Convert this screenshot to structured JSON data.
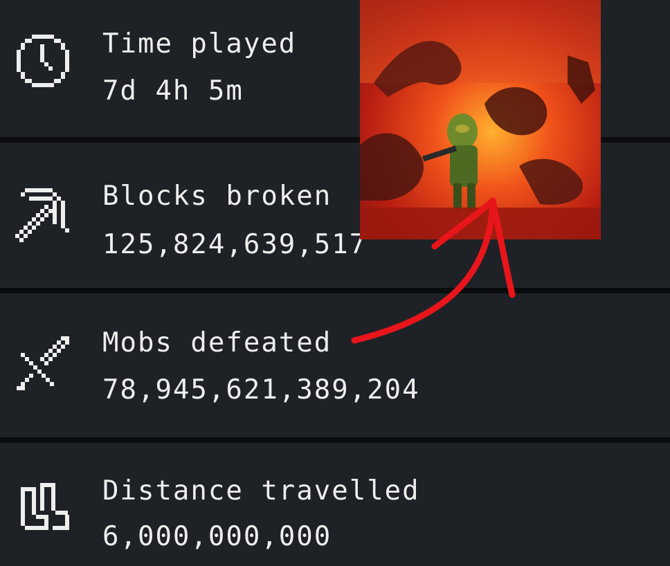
{
  "stats": [
    {
      "icon": "clock-icon",
      "label": "Time played",
      "value": "7d 4h 5m"
    },
    {
      "icon": "pickaxe-icon",
      "label": "Blocks broken",
      "value": "125,824,639,517"
    },
    {
      "icon": "sword-icon",
      "label": "Mobs defeated",
      "value": "78,945,621,389,204"
    },
    {
      "icon": "boots-icon",
      "label": "Distance travelled",
      "value": "6,000,000,000"
    }
  ],
  "colors": {
    "row_background": "#1e2226",
    "separator": "#0a0c0e",
    "text": "#eeeeee",
    "arrow": "#e8151b"
  }
}
